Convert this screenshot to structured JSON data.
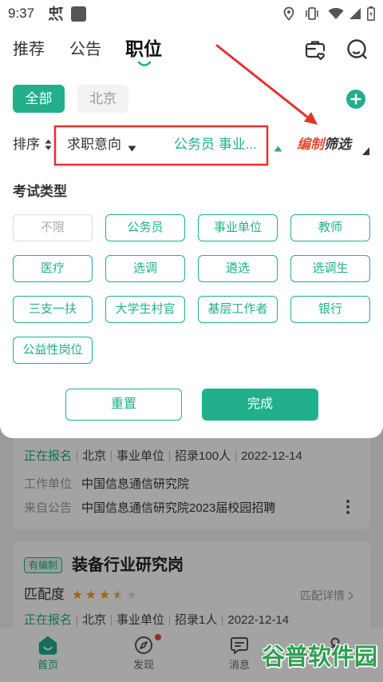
{
  "status_bar": {
    "time": "9:37"
  },
  "top_tabs": [
    {
      "label": "推荐",
      "active": false
    },
    {
      "label": "公告",
      "active": false
    },
    {
      "label": "职位",
      "active": true
    }
  ],
  "header_icons": [
    "briefcase-heart-icon",
    "search-icon"
  ],
  "region_chips": [
    {
      "label": "全部",
      "selected": true
    },
    {
      "label": "北京",
      "selected": false
    }
  ],
  "filter_bar": {
    "sort_label": "排序",
    "intent_label": "求职意向",
    "intent_value": "公务员 事业...",
    "establishment_label": "编制",
    "filter_label": "筛选"
  },
  "exam_type_panel": {
    "section_title": "考试类型",
    "options": [
      {
        "label": "不限",
        "selected": false
      },
      {
        "label": "公务员",
        "selected": true
      },
      {
        "label": "事业单位",
        "selected": true
      },
      {
        "label": "教师",
        "selected": true
      },
      {
        "label": "医疗",
        "selected": true
      },
      {
        "label": "选调",
        "selected": true
      },
      {
        "label": "遴选",
        "selected": true
      },
      {
        "label": "选调生",
        "selected": true
      },
      {
        "label": "三支一扶",
        "selected": true
      },
      {
        "label": "大学生村官",
        "selected": true
      },
      {
        "label": "基层工作者",
        "selected": true
      },
      {
        "label": "银行",
        "selected": true
      },
      {
        "label": "公益性岗位",
        "selected": true
      }
    ],
    "reset_label": "重置",
    "done_label": "完成"
  },
  "job_list": [
    {
      "status": "正在报名",
      "city": "北京",
      "org_type": "事业单位",
      "quota": "招录100人",
      "date": "2022-12-14",
      "employer_label": "工作单位",
      "employer": "中国信息通信研究院",
      "source_label": "来自公告",
      "source": "中国信息通信研究院2023届校园招聘"
    },
    {
      "badge": "有编制",
      "title": "装备行业研究岗",
      "match_label": "匹配度",
      "match_rating": 3.5,
      "match_rating_max": 5,
      "match_detail_label": "匹配详情",
      "status": "正在报名",
      "city": "北京",
      "org_type": "事业单位",
      "quota": "招录1人",
      "date": "2022-12-14"
    }
  ],
  "bottom_nav": [
    {
      "label": "首页",
      "active": true,
      "icon": "home-icon"
    },
    {
      "label": "发现",
      "active": false,
      "icon": "compass-icon",
      "badge_dot": true
    },
    {
      "label": "消息",
      "active": false,
      "icon": "chat-icon"
    }
  ],
  "watermark": "谷普软件园",
  "colors": {
    "accent": "#22b08c",
    "establishment_red": "#e64a2e",
    "annotation_red": "#e5322d",
    "star": "#f5a623",
    "badge_dot": "#f0453a"
  }
}
